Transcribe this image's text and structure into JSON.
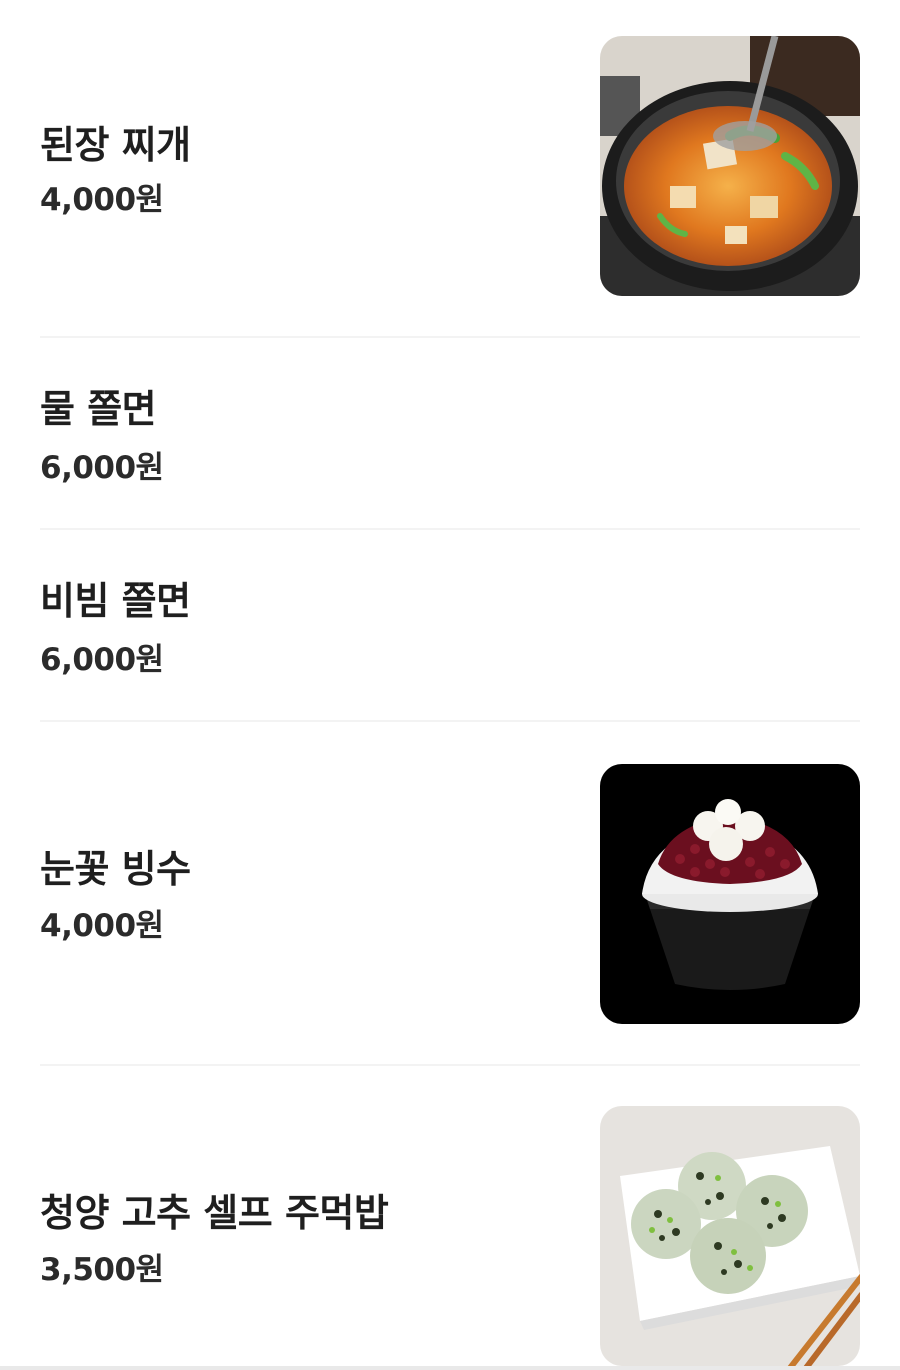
{
  "menu": {
    "items": [
      {
        "name": "된장 찌개",
        "price": "4,000원",
        "image": "doenjang-stew-photo"
      },
      {
        "name": "물 쫄면",
        "price": "6,000원",
        "image": null
      },
      {
        "name": "비빔 쫄면",
        "price": "6,000원",
        "image": null
      },
      {
        "name": "눈꽃 빙수",
        "price": "4,000원",
        "image": "snowflake-bingsu-photo"
      },
      {
        "name": "청양 고추 셀프 주먹밥",
        "price": "3,500원",
        "image": "rice-ball-photo"
      }
    ]
  }
}
